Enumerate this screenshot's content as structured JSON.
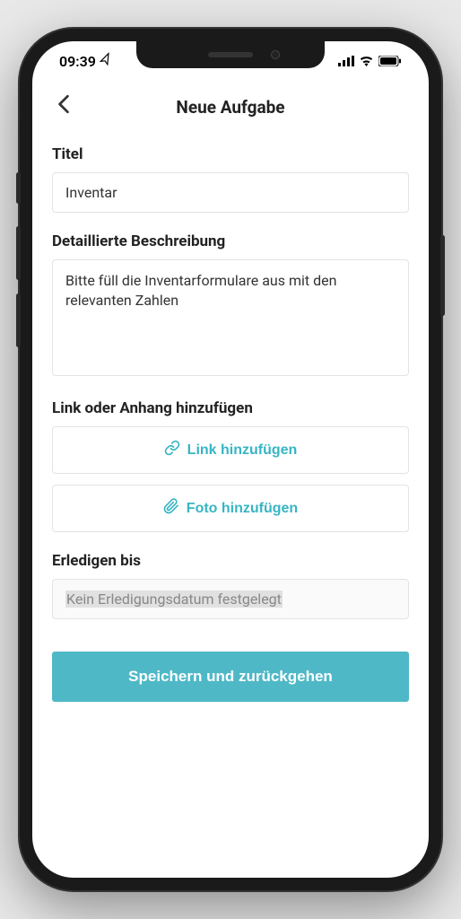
{
  "status": {
    "time": "09:39",
    "location_glyph": "➤"
  },
  "nav": {
    "title": "Neue Aufgabe"
  },
  "form": {
    "title_label": "Titel",
    "title_value": "Inventar",
    "desc_label": "Detaillierte Beschreibung",
    "desc_value": "Bitte füll die Inventarformulare aus mit den relevanten Zahlen",
    "attach_label": "Link oder Anhang hinzufügen",
    "link_btn": "Link hinzufügen",
    "photo_btn": "Foto hinzufügen",
    "due_label": "Erledigen bis",
    "due_value": "Kein Erledigungsdatum festgelegt",
    "submit": "Speichern und zurückgehen"
  },
  "colors": {
    "accent": "#37b5c4",
    "submit_bg": "#4fb8c6"
  }
}
